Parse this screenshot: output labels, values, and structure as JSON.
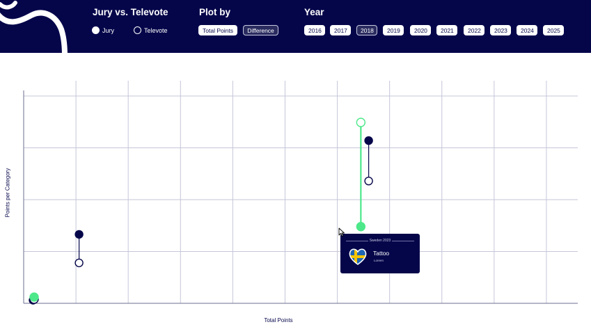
{
  "header": {
    "mode_group": {
      "title": "Jury vs. Televote",
      "options": [
        {
          "label": "Jury",
          "selected": true
        },
        {
          "label": "Televote",
          "selected": false
        }
      ]
    },
    "plot_group": {
      "title": "Plot by",
      "options": [
        {
          "label": "Total Points",
          "selected": false
        },
        {
          "label": "Difference",
          "selected": true
        }
      ]
    },
    "year_group": {
      "title": "Year",
      "years": [
        {
          "label": "2016",
          "selected": false
        },
        {
          "label": "2017",
          "selected": false
        },
        {
          "label": "2018",
          "selected": true
        },
        {
          "label": "2019",
          "selected": false
        },
        {
          "label": "2020",
          "selected": false
        },
        {
          "label": "2021",
          "selected": false
        },
        {
          "label": "2022",
          "selected": false
        },
        {
          "label": "2023",
          "selected": false
        },
        {
          "label": "2024",
          "selected": false
        },
        {
          "label": "2025",
          "selected": false
        }
      ]
    }
  },
  "colors": {
    "navy": "#05064a",
    "green": "#4de88a",
    "grid": "#c5c6d8",
    "white": "#ffffff"
  },
  "chart_data": {
    "type": "scatter",
    "xlabel": "Total Points",
    "ylabel": "Points per Category",
    "xlim": [
      0,
      10.6
    ],
    "ylim": [
      0,
      4
    ],
    "grid": true,
    "pairs": [
      {
        "x": 0.2,
        "y_top": 0.12,
        "y_bottom": 0.08,
        "color": "#4de88a",
        "top_filled": true,
        "bottom_filled": false,
        "top_color": "#4de88a",
        "bottom_color": "#05064a",
        "bottom_left_filled": true
      },
      {
        "x": 1.06,
        "y_top": 1.33,
        "y_bottom": 0.78,
        "color": "#05064a",
        "top_filled": true,
        "bottom_filled": false
      },
      {
        "x": 6.45,
        "y_top": 3.49,
        "y_bottom": 1.48,
        "color": "#4de88a",
        "top_filled": false,
        "bottom_filled": true
      },
      {
        "x": 6.6,
        "y_top": 3.14,
        "y_bottom": 2.36,
        "color": "#05064a",
        "top_filled": true,
        "bottom_filled": false
      }
    ]
  },
  "tooltip": {
    "header": "Sweden 2023",
    "song": "Tattoo",
    "artist": "Loreen",
    "icon": "sweden-heart-icon"
  }
}
